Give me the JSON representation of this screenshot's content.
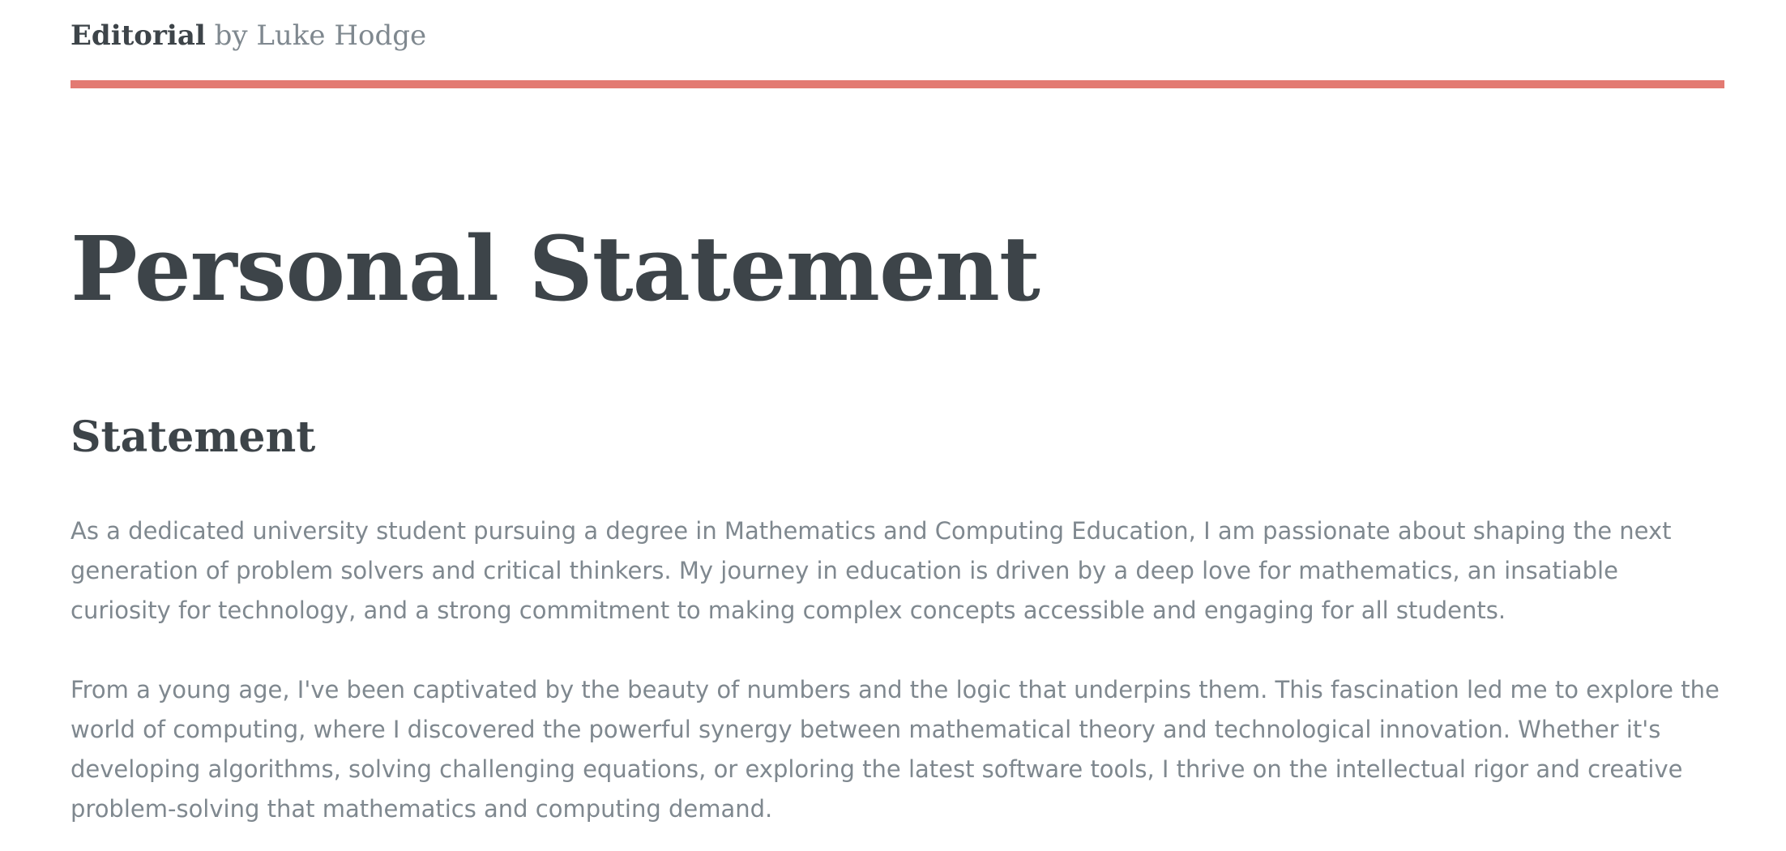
{
  "header": {
    "brand_name": "Editorial",
    "brand_byline": " by Luke Hodge",
    "accent_color": "#e37a72"
  },
  "main": {
    "title": "Personal Statement",
    "section_heading": "Statement",
    "paragraphs": [
      "As a dedicated university student pursuing a degree in Mathematics and Computing Education, I am passionate about shaping the next generation of problem solvers and critical thinkers. My journey in education is driven by a deep love for mathematics, an insatiable curiosity for technology, and a strong commitment to making complex concepts accessible and engaging for all students.",
      "From a young age, I've been captivated by the beauty of numbers and the logic that underpins them. This fascination led me to explore the world of computing, where I discovered the powerful synergy between mathematical theory and technological innovation. Whether it's developing algorithms, solving challenging equations, or exploring the latest software tools, I thrive on the intellectual rigor and creative problem-solving that mathematics and computing demand."
    ]
  }
}
